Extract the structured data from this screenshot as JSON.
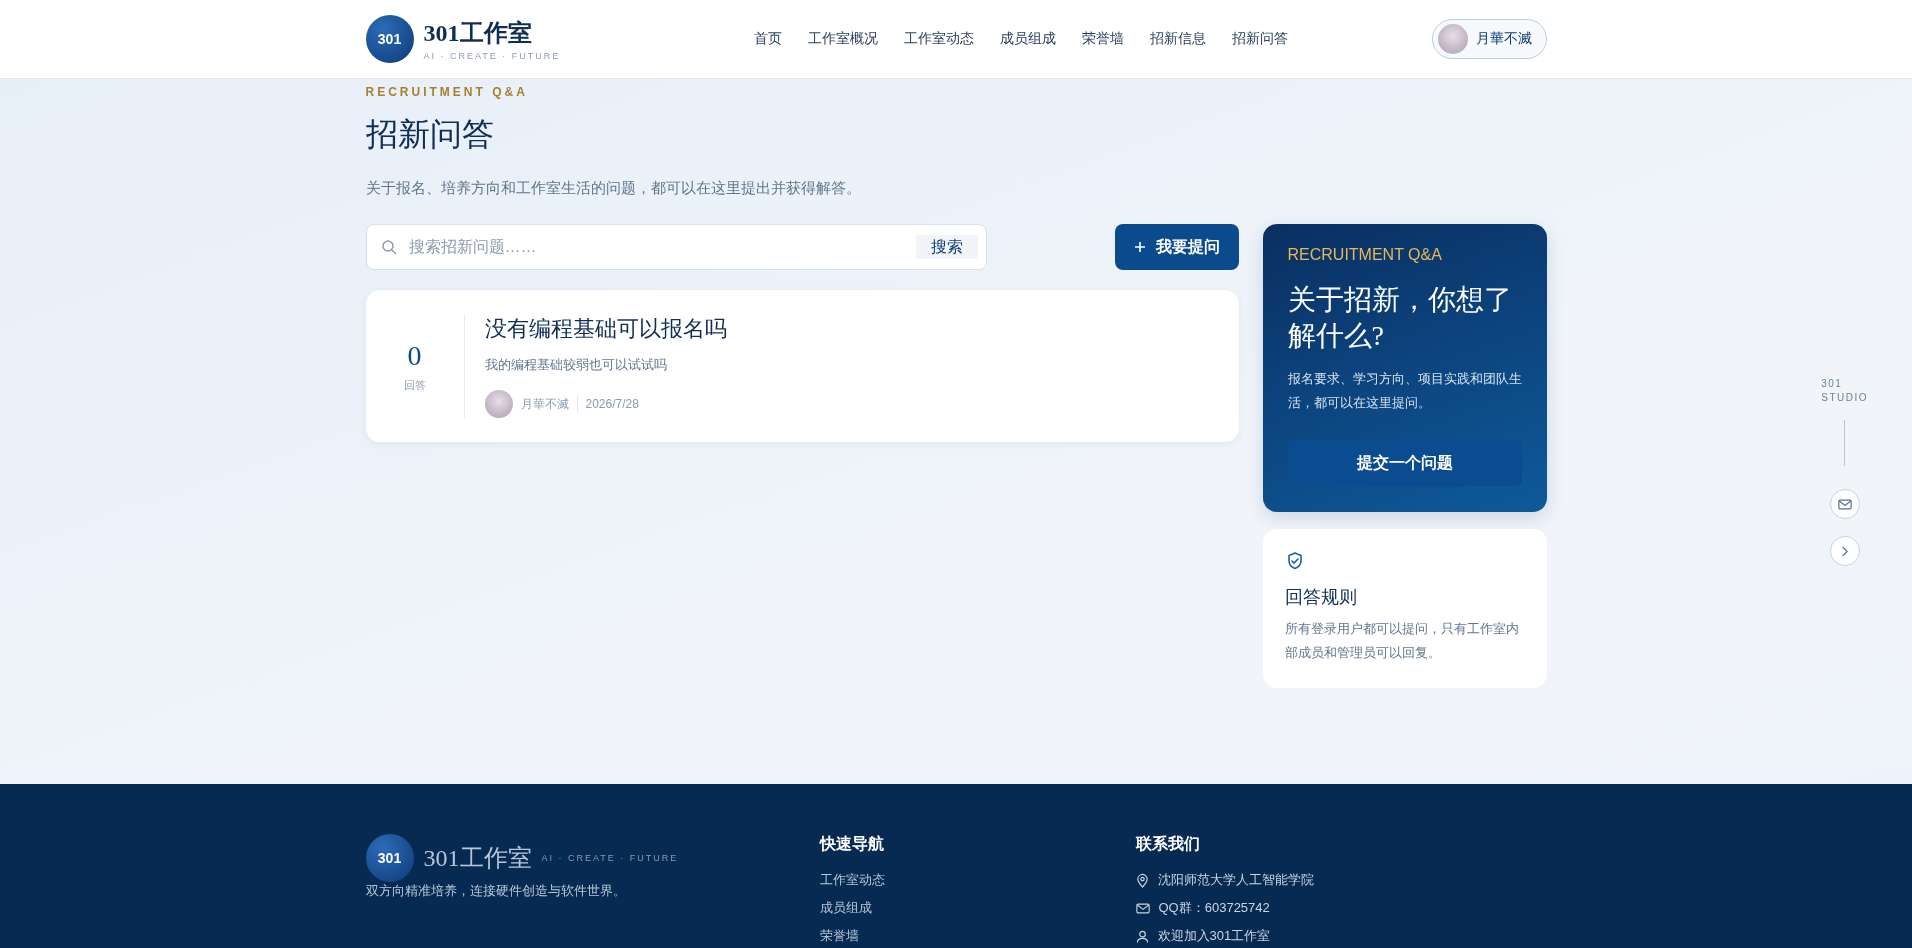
{
  "header": {
    "logo_mark": "301",
    "logo_title": "301工作室",
    "logo_tagline": "AI · CREATE · FUTURE",
    "nav": [
      {
        "label": "首页",
        "selected": false
      },
      {
        "label": "工作室概况",
        "selected": false
      },
      {
        "label": "工作室动态",
        "selected": false
      },
      {
        "label": "成员组成",
        "selected": false
      },
      {
        "label": "荣誉墙",
        "selected": false
      },
      {
        "label": "招新信息",
        "selected": false
      },
      {
        "label": "招新问答",
        "selected": false
      }
    ],
    "user": "月華不滅"
  },
  "page": {
    "eyebrow": "RECRUITMENT Q&A",
    "title": "招新问答",
    "subtitle": "关于报名、培养方向和工作室生活的问题，都可以在这里提出并获得解答。"
  },
  "search": {
    "placeholder": "搜索招新问题……",
    "button": "搜索"
  },
  "ask_button": "我要提问",
  "questions": [
    {
      "answers": "0",
      "answers_label": "回答",
      "title": "没有编程基础可以报名吗",
      "excerpt": "我的编程基础较弱也可以试试吗",
      "author": "月華不滅",
      "date": "2026/7/28"
    }
  ],
  "promo": {
    "eyebrow": "RECRUITMENT Q&A",
    "title": "关于招新，你想了解什么?",
    "text": "报名要求、学习方向、项目实践和团队生活，都可以在这里提问。",
    "button": "提交一个问题"
  },
  "rules": {
    "title": "回答规则",
    "text": "所有登录用户都可以提问，只有工作室内部成员和管理员可以回复。"
  },
  "side_rail": {
    "label_1": "301",
    "label_2": "STUDIO"
  },
  "footer": {
    "logo_mark": "301",
    "logo_title": "301工作室",
    "logo_tagline": "AI · CREATE · FUTURE",
    "slogan": "双方向精准培养，连接硬件创造与软件世界。",
    "nav_title": "快速导航",
    "nav_links": [
      "工作室动态",
      "成员组成",
      "荣誉墙"
    ],
    "contact_title": "联系我们",
    "contacts": [
      {
        "kind": "location",
        "text": "沈阳师范大学人工智能学院"
      },
      {
        "kind": "mail",
        "text": "QQ群：603725742"
      },
      {
        "kind": "user",
        "text": "欢迎加入301工作室"
      }
    ]
  }
}
